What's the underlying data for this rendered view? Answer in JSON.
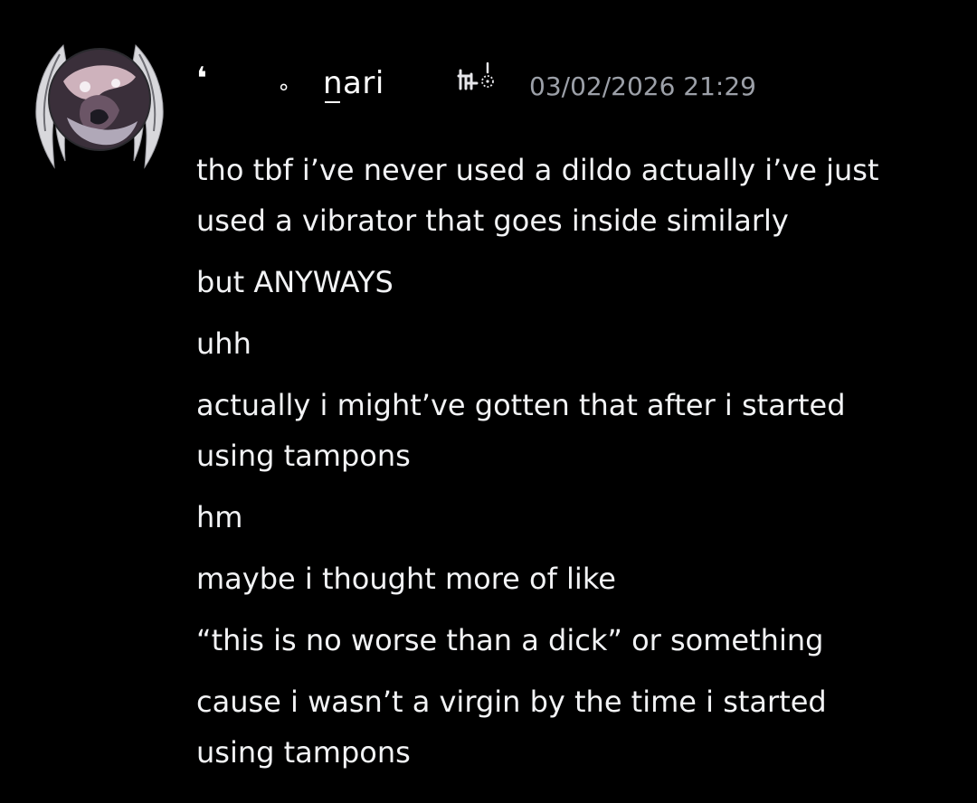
{
  "message": {
    "author": {
      "display_prefix": "❛",
      "display_dot": "∘",
      "username": "nari",
      "badge_icon": "tag-badge-icon",
      "avatar_icon": "winged-avatar-icon"
    },
    "timestamp": "03/02/2026 21:29",
    "lines": [
      {
        "text": "tho tbf i’ve never used a dildo actually i’ve just"
      },
      {
        "text": "used a vibrator that goes inside similarly"
      },
      {
        "text": "but ANYWAYS"
      },
      {
        "text": "uhh"
      },
      {
        "text": "actually i might’ve gotten that after i started"
      },
      {
        "text": "using tampons"
      },
      {
        "text": "hm"
      },
      {
        "text": "maybe i thought more of like"
      },
      {
        "text": "“this is no worse than a dick” or something"
      },
      {
        "text": "cause i wasn’t a virgin by the time i started"
      },
      {
        "text": "using tampons"
      }
    ]
  },
  "colors": {
    "background": "#000000",
    "text": "#f2f3f5",
    "timestamp": "#9ca0a8"
  }
}
